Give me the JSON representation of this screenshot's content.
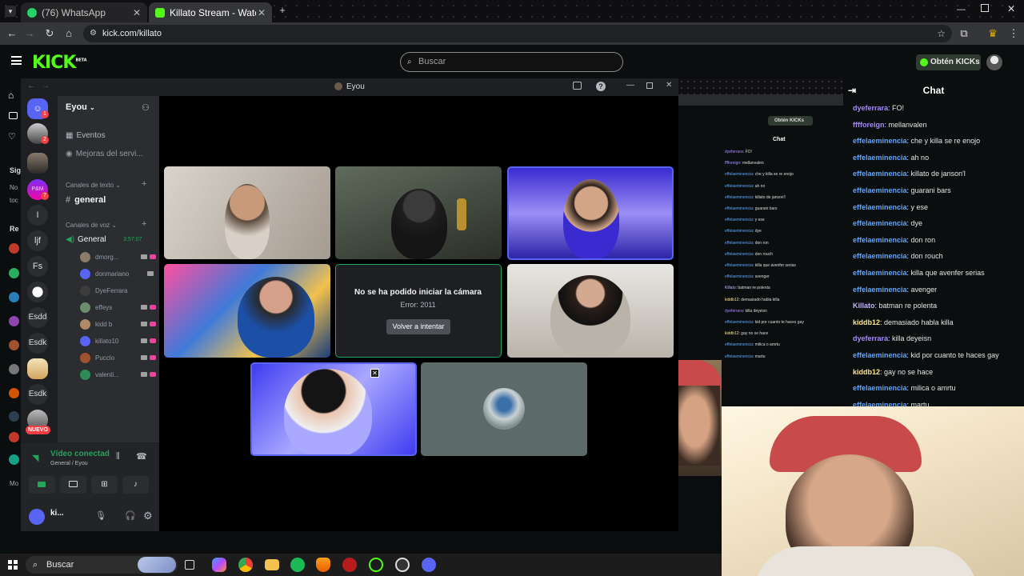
{
  "browser": {
    "tabs": [
      {
        "title": "(76) WhatsApp",
        "active": false,
        "favicon": "whatsapp-icon"
      },
      {
        "title": "Killato Stream - Watch Live on K",
        "active": true,
        "favicon": "kick-icon"
      }
    ],
    "url": "kick.com/killato"
  },
  "kick": {
    "logo": "KICK",
    "logo_tag": "BETA",
    "search_placeholder": "Buscar",
    "cta": "Obtén KICKs",
    "rail_labels": [
      "Sig",
      "No",
      "toc",
      "Re",
      "Mo"
    ],
    "new_badge": "NUEVO",
    "chat": {
      "title": "Chat",
      "messages": [
        {
          "user": "dyeferrara",
          "text": "FO!",
          "color": "#a78bfa"
        },
        {
          "user": "fffforeign",
          "text": "mellanvalen",
          "color": "#a78bfa"
        },
        {
          "user": "effelaeminencia",
          "text": "che y killa se re enojo",
          "color": "#60a5fa"
        },
        {
          "user": "effelaeminencia",
          "text": "ah no",
          "color": "#60a5fa"
        },
        {
          "user": "effelaeminencia",
          "text": "killato de janson'l",
          "color": "#60a5fa"
        },
        {
          "user": "effelaeminencia",
          "text": "guarani bars",
          "color": "#60a5fa"
        },
        {
          "user": "effelaeminencia",
          "text": "y ese",
          "color": "#60a5fa"
        },
        {
          "user": "effelaeminencia",
          "text": "dye",
          "color": "#60a5fa"
        },
        {
          "user": "effelaeminencia",
          "text": "don ron",
          "color": "#60a5fa"
        },
        {
          "user": "effelaeminencia",
          "text": "don rouch",
          "color": "#60a5fa"
        },
        {
          "user": "effelaeminencia",
          "text": "killa que avenfer serias",
          "color": "#60a5fa"
        },
        {
          "user": "effelaeminencia",
          "text": "avenger",
          "color": "#60a5fa"
        },
        {
          "user": "Killato",
          "text": "batman re polenta",
          "color": "#c4b5fd"
        },
        {
          "user": "kiddb12",
          "text": "demasiado habla killa",
          "color": "#fde68a"
        },
        {
          "user": "dyeferrara",
          "text": "killa deyeisn",
          "color": "#a78bfa"
        },
        {
          "user": "effelaeminencia",
          "text": "kid por cuanto te haces gay",
          "color": "#60a5fa"
        },
        {
          "user": "kiddb12",
          "text": "gay no se hace",
          "color": "#fde68a"
        },
        {
          "user": "effelaeminencia",
          "text": "milica o amrtu",
          "color": "#60a5fa"
        },
        {
          "user": "effelaeminencia",
          "text": "martu",
          "color": "#60a5fa"
        }
      ]
    }
  },
  "discord": {
    "window_title": "Eyou",
    "server_name": "Eyou",
    "server_icons": [
      "I",
      "ljf",
      "Fs",
      "Esdd",
      "Esdk",
      "Esdk"
    ],
    "server_badges": [
      "1",
      "2",
      "7"
    ],
    "events": "Eventos",
    "boosts": "Mejoras del servi...",
    "text_category": "Canales de texto",
    "text_channel": "general",
    "voice_category": "Canales de voz",
    "voice_channel": "General",
    "voice_timer": "3:57:07",
    "voice_users": [
      {
        "name": "dmorg...",
        "color": "#8b7b6b"
      },
      {
        "name": "donmariano",
        "color": "#5865f2"
      },
      {
        "name": "DyeFerrara",
        "color": "#3c3c3c"
      },
      {
        "name": "effeys",
        "color": "#6b8e6b"
      },
      {
        "name": "kidd b",
        "color": "#b08968"
      },
      {
        "name": "killato10",
        "color": "#5865f2"
      },
      {
        "name": "Pucclo",
        "color": "#a0522d"
      },
      {
        "name": "valenti...",
        "color": "#2e8b57"
      }
    ],
    "voice_status": "Vídeo conectad",
    "voice_location": "General / Eyou",
    "user_name": "ki...",
    "camera_error": {
      "title": "No se ha podido iniciar la cámara",
      "code": "Error: 2011",
      "retry": "Volver a intentar"
    }
  },
  "taskbar": {
    "search_placeholder": "Buscar"
  }
}
